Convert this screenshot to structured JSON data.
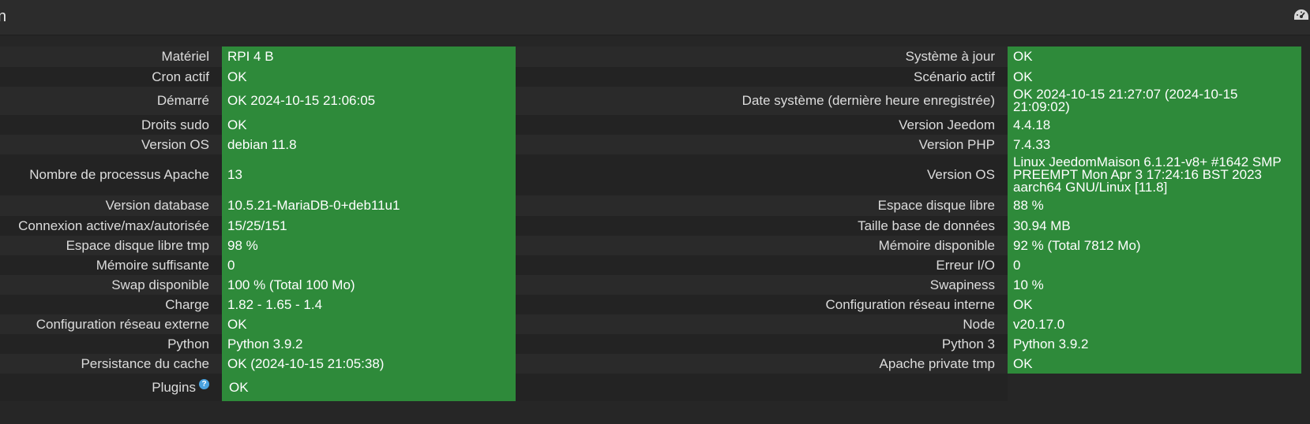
{
  "header": {
    "title": "n",
    "icon": "dashboard-gauge-icon"
  },
  "rows": [
    {
      "left_label": "Matériel",
      "left_value": "RPI 4 B",
      "right_label": "Système à jour",
      "right_value": "OK"
    },
    {
      "left_label": "Cron actif",
      "left_value": "OK",
      "right_label": "Scénario actif",
      "right_value": "OK"
    },
    {
      "left_label": "Démarré",
      "left_value": "OK 2024-10-15 21:06:05",
      "right_label": "Date système (dernière heure enregistrée)",
      "right_value": "OK 2024-10-15 21:27:07 (2024-10-15 21:09:02)"
    },
    {
      "left_label": "Droits sudo",
      "left_value": "OK",
      "right_label": "Version Jeedom",
      "right_value": "4.4.18"
    },
    {
      "left_label": "Version OS",
      "left_value": "debian 11.8",
      "right_label": "Version PHP",
      "right_value": "7.4.33"
    },
    {
      "left_label": "Nombre de processus Apache",
      "left_value": "13",
      "right_label": "Version OS",
      "right_value": "Linux JeedomMaison 6.1.21-v8+ #1642 SMP PREEMPT Mon Apr 3 17:24:16 BST 2023 aarch64 GNU/Linux [11.8]"
    },
    {
      "left_label": "Version database",
      "left_value": "10.5.21-MariaDB-0+deb11u1",
      "right_label": "Espace disque libre",
      "right_value": "88 %"
    },
    {
      "left_label": "Connexion active/max/autorisée",
      "left_value": "15/25/151",
      "right_label": "Taille base de données",
      "right_value": "30.94 MB"
    },
    {
      "left_label": "Espace disque libre tmp",
      "left_value": "98 %",
      "right_label": "Mémoire disponible",
      "right_value": "92 % (Total 7812 Mo)"
    },
    {
      "left_label": "Mémoire suffisante",
      "left_value": "0",
      "right_label": "Erreur I/O",
      "right_value": "0"
    },
    {
      "left_label": "Swap disponible",
      "left_value": "100 % (Total 100 Mo)",
      "right_label": "Swapiness",
      "right_value": "10 %"
    },
    {
      "left_label": "Charge",
      "left_value": "1.82 - 1.65 - 1.4",
      "right_label": "Configuration réseau interne",
      "right_value": "OK"
    },
    {
      "left_label": "Configuration réseau externe",
      "left_value": "OK",
      "right_label": "Node",
      "right_value": "v20.17.0"
    },
    {
      "left_label": "Python",
      "left_value": "Python 3.9.2",
      "right_label": "Python 3",
      "right_value": "Python 3.9.2"
    },
    {
      "left_label": "Persistance du cache",
      "left_value": "OK (2024-10-15 21:05:38)",
      "right_label": "Apache private tmp",
      "right_value": "OK"
    }
  ],
  "plugins_row": {
    "label": "Plugins",
    "help_icon": "question-circle-icon",
    "value": "OK"
  },
  "colors": {
    "ok_green": "#2e8a3a",
    "background": "#262626"
  }
}
